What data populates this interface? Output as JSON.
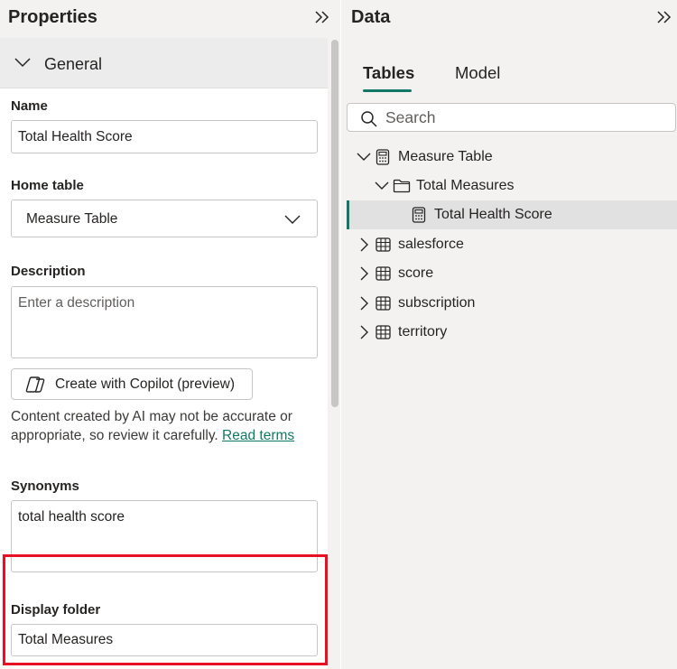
{
  "properties": {
    "title": "Properties",
    "section": "General",
    "name_label": "Name",
    "name_value": "Total Health Score",
    "home_table_label": "Home table",
    "home_table_value": "Measure Table",
    "description_label": "Description",
    "description_placeholder": "Enter a description",
    "copilot_button": "Create with Copilot (preview)",
    "ai_note": "Content created by AI may not be accurate or appropriate, so review it carefully.",
    "read_terms": "Read terms",
    "synonyms_label": "Synonyms",
    "synonyms_value": "total health score",
    "display_folder_label": "Display folder",
    "display_folder_value": "Total Measures"
  },
  "data_pane": {
    "title": "Data",
    "tabs": [
      "Tables",
      "Model"
    ],
    "active_tab": "Tables",
    "search_placeholder": "Search",
    "tree": {
      "measure_table": "Measure Table",
      "folder": "Total Measures",
      "measure": "Total Health Score",
      "tables": [
        "salesforce",
        "score",
        "subscription",
        "territory"
      ]
    }
  },
  "colors": {
    "accent": "#117865",
    "highlight": "#e81123",
    "pane_bg": "#f3f2f1",
    "selected_row": "#e1e1e1"
  },
  "icons": {
    "collapse": "double-chevron-right-icon",
    "section_toggle": "chevron-down-icon",
    "dropdown": "chevron-down-icon",
    "copilot": "copilot-icon",
    "search": "search-icon",
    "calculator": "calculator-icon",
    "folder": "folder-icon",
    "table": "table-icon",
    "expand": "chevron-right-icon"
  }
}
